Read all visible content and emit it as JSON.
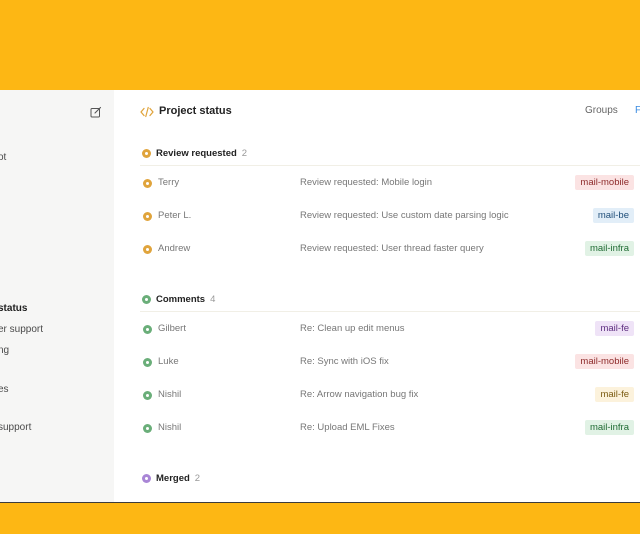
{
  "sidebar": {
    "items": [
      {
        "label": "ot"
      },
      {
        "label": "status"
      },
      {
        "label": "er support"
      },
      {
        "label": "ng"
      },
      {
        "label": "es"
      },
      {
        "label": "support"
      }
    ]
  },
  "header": {
    "title": "Project status",
    "groups_label": "Groups",
    "partial_link": "F"
  },
  "sections": [
    {
      "label": "Review requested",
      "count": "2",
      "rows": [
        {
          "name": "Terry",
          "subject": "Review requested: Mobile login",
          "tag": "mail-mobile"
        },
        {
          "name": "Peter L.",
          "subject": "Review requested: Use custom date parsing logic",
          "tag": "mail-be"
        },
        {
          "name": "Andrew",
          "subject": "Review requested: User thread faster query",
          "tag": "mail-infra"
        }
      ]
    },
    {
      "label": "Comments",
      "count": "4",
      "rows": [
        {
          "name": "Gilbert",
          "subject": "Re: Clean up edit menus",
          "tag": "mail-fe"
        },
        {
          "name": "Luke",
          "subject": "Re: Sync with iOS fix",
          "tag": "mail-mobile"
        },
        {
          "name": "Nishil",
          "subject": "Re: Arrow navigation bug fix",
          "tag": "mail-fe"
        },
        {
          "name": "Nishil",
          "subject": "Re: Upload EML Fixes",
          "tag": "mail-infra"
        }
      ]
    },
    {
      "label": "Merged",
      "count": "2",
      "rows": []
    }
  ],
  "colors": {
    "background_band": "#FDB714",
    "review_requested_dot": "#E0A43C",
    "comments_dot": "#6AAE79",
    "merged_dot": "#A986D6",
    "link_blue": "#3a8be0"
  },
  "icons": {
    "compose": "compose-icon",
    "header": "code-icon",
    "status_dot": "status-dot-icon"
  }
}
